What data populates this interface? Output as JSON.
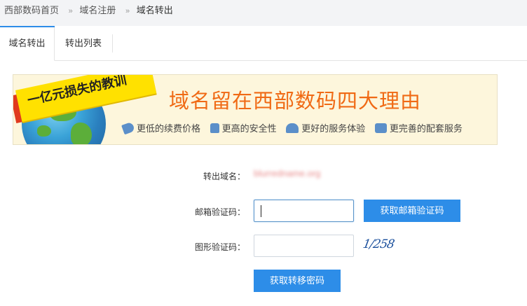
{
  "breadcrumb": {
    "items": [
      "西部数码首页",
      "域名注册",
      "域名转出"
    ],
    "separator": "»"
  },
  "tabs": [
    {
      "label": "域名转出",
      "active": true
    },
    {
      "label": "转出列表",
      "active": false
    }
  ],
  "banner": {
    "ribbon_text": "一亿元损失的教训",
    "title": "域名留在西部数码四大理由",
    "features": [
      {
        "icon": "tag-icon",
        "label": "更低的续费价格"
      },
      {
        "icon": "lock-icon",
        "label": "更高的安全性"
      },
      {
        "icon": "users-icon",
        "label": "更好的服务体验"
      },
      {
        "icon": "box-icon",
        "label": "更完善的配套服务"
      }
    ]
  },
  "form": {
    "domain_label": "转出域名：",
    "domain_value": "blurredname.org",
    "email_code_label": "邮箱验证码：",
    "email_code_value": "",
    "get_email_code_button": "获取邮箱验证码",
    "captcha_label": "图形验证码：",
    "captcha_value": "",
    "captcha_text": "1/258",
    "submit_button": "获取转移密码"
  },
  "colors": {
    "accent": "#2d8de8",
    "banner_title": "#f06a15",
    "ribbon": "#ffe100"
  }
}
